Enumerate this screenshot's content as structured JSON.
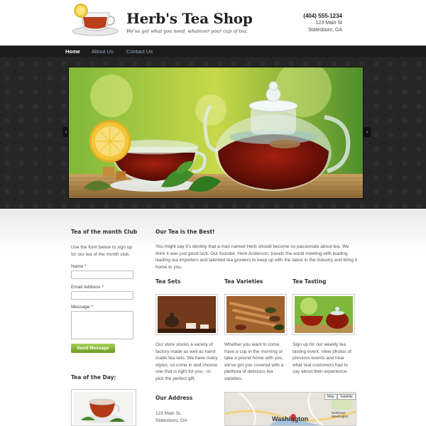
{
  "header": {
    "brand_name": "Herb's Tea Shop",
    "tagline": "We've got what you need, whatever your cup of tea.",
    "phone": "(404) 555-1234",
    "address_line1": "123 Main St",
    "address_line2": "Statesboro, GA"
  },
  "nav": {
    "items": [
      {
        "label": "Home",
        "active": true
      },
      {
        "label": "About Us",
        "active": false
      },
      {
        "label": "Contact Us",
        "active": false
      }
    ]
  },
  "slider": {
    "prev_icon": "chevron-left-icon",
    "next_icon": "chevron-right-icon"
  },
  "sidebar": {
    "club_title": "Tea of the month Club",
    "club_text": "Use the form below to sign up for our tea of the month club.",
    "name_label": "Name *",
    "email_label": "Email Address *",
    "message_label": "Message *",
    "send_label": "Send Message",
    "tea_of_day_title": "Tea of the Day:"
  },
  "main": {
    "title": "Our Tea is the Best!",
    "intro": "You might say it's destiny that a man named Herb should become so passionate about tea. We think it was just good luck. Our founder, Herb Anderson, travels the world meeting with leading leading tea importers and talented tea growers to keep up with the latest in the industry and bring it home to you.",
    "columns": [
      {
        "title": "Tea Sets",
        "text": "Our store stocks a variety of factory made as well as hand made tea sets. We have many styles, so come in and choose one that is right for you - or pick the perfect gift."
      },
      {
        "title": "Tea Varieties",
        "text": "Whether you want to come have a cup in the morning or take a pound home with you, we've got you covered with a plethora of delicious tea varieties."
      },
      {
        "title": "Tea Tasting",
        "text": "Sign up for our weekly tea tasting event. View photos of previous events and hear what real customers had to say about their experience."
      }
    ],
    "address_title": "Our Address",
    "address_line1": "123 Main St.",
    "address_line2": "Statesboro, GA"
  },
  "map": {
    "map_btn": "Map",
    "satellite_btn": "Satellite",
    "city_label": "Washington",
    "area_label": "Northeast Washington"
  },
  "colors": {
    "nav_bg": "#1b1b1b",
    "accent_green": "#7da52e",
    "hero_bg": "#262626"
  }
}
